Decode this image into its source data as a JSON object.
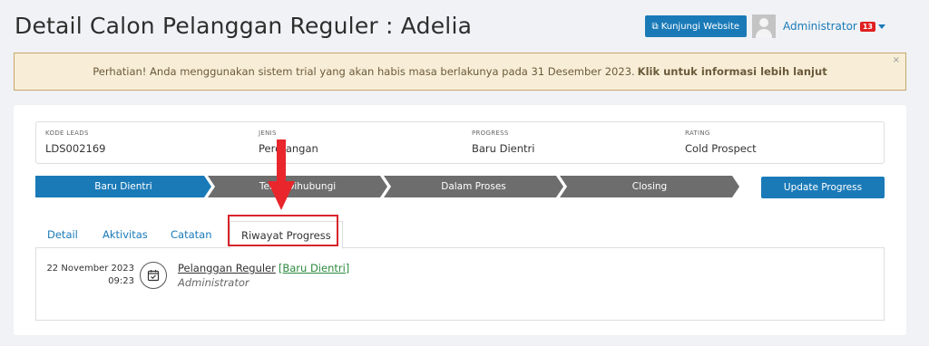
{
  "header": {
    "title": "Detail Calon Pelanggan Reguler : Adelia",
    "website_button": "Kunjungi Website",
    "user_name": "Administrator",
    "notification_count": "13"
  },
  "alert": {
    "message": "Perhatian! Anda menggunakan sistem trial yang akan habis masa berlakunya pada 31 Desember 2023.",
    "link": "Klik untuk informasi lebih lanjut",
    "close": "×"
  },
  "info": {
    "kode_label": "KODE LEADS",
    "kode_value": "LDS002169",
    "jenis_label": "JENIS",
    "jenis_value": "Perorangan",
    "progress_label": "PROGRESS",
    "progress_value": "Baru Dientri",
    "rating_label": "RATING",
    "rating_value": "Cold Prospect"
  },
  "steps": [
    "Baru Dientri",
    "Telah Dihubungi",
    "Dalam Proses",
    "Closing"
  ],
  "update_button": "Update Progress",
  "tabs": [
    "Detail",
    "Aktivitas",
    "Catatan",
    "Riwayat Progress"
  ],
  "history": {
    "date": "22 November 2023",
    "time": "09:23",
    "title": "Pelanggan Reguler",
    "status": "[Baru Dientri]",
    "user": "Administrator"
  },
  "colors": {
    "primary": "#1a7ab8",
    "step_inactive": "#6d6d6d",
    "highlight": "#d8242b",
    "alert_bg": "#f8eed8"
  }
}
